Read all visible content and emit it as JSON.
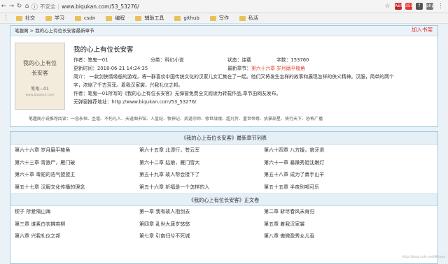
{
  "browser": {
    "insecure": "不安全",
    "url": "www.biqukan.com/53_53276/",
    "ext_labels": [
      "ABP",
      "355",
      "f",
      "php"
    ]
  },
  "bookmarks": [
    "社交",
    "学习",
    "csdn",
    "编程",
    "辅助工具",
    "github",
    "写作",
    "私活"
  ],
  "breadcrumb": "笔趣阁 > 我的心上有位长安客最新章节",
  "join": "加入书架",
  "cover": {
    "title": "我的心上有位长安客",
    "author": "笔鬼—01",
    "url": "www.biqukan.com"
  },
  "book": {
    "title": "我的心上有位长安客",
    "author": "作者：笔鬼一01",
    "category": "分类：科幻小说",
    "status": "状态：连载",
    "words": "字数：153760",
    "updated": "更新时间：2018-06-21 14:24:35",
    "latest_label": "最新章节：",
    "latest": "第六十六章 岁月磨平棱角",
    "intro": "简介： 一款剑侠情缘般的游戏，将一群喜欢中国传统文化的汉家儿女汇集在了一起。他们又将发生怎样的故事和展现怎样的侠义精神。汉服，简单的两个字，浓缩了千古芳菲。着我汉家裳，兴我礼仪之邦。",
    "author_note": "作者：笔鬼一01所写的《我的心上有位长安客》无弹窗免费全文阅读为转载作品,章节由网友发布。",
    "share": "无弹窗推荐地址：http://www.biqukan.com/53_53276/"
  },
  "hot": "笔趣阁小说推荐阅读：一念永恒、圣墟、不朽凡人、天道图书馆、人皇纪、牧神记、武道宗师、修世战魂、超凡传、重世帝尊、执掌部星、侠行天下、恐怖广播",
  "latest_header": "《我的心上有位长安客》最新章节列表",
  "latest_chapters": [
    "第六十六章 岁月磨平棱角",
    "第六十五章 北漂行，苍云军",
    "第六十四章 八方援，狼牙退",
    "第六十三章 青狼尸，雁门破",
    "第六十二章 姑娘，雁门雪大",
    "第六十一章 暴躁秀姐沈嫩灯",
    "第六十章 毒蛇的浩气盟盟主",
    "第五十九章 故人帮会接下了",
    "第五十八章 成为了勇手山羊",
    "第五十七章 汉服文化传播的理念",
    "第五十六章 祈福是一个怎样的人",
    "第五十五章 半夜别喝可乐"
  ],
  "toc_header": "《我的心上有位长安客》正文卷",
  "toc_chapters": [
    "楔子 所爱隔山海",
    "第一章 我有故人抱剑去",
    "第二章 斩尽春风未肯归",
    "第三章 谁素白衣拂若柳",
    "第四章 乱世大唐岁悠悠",
    "第五章 着我汉家裳",
    "第六章 兴我礼仪之邦",
    "第七章 引南归兮不死城",
    "第八章 傲微盈秀女儿香"
  ],
  "watermark": "http://blog.csdn.net/Misaya"
}
